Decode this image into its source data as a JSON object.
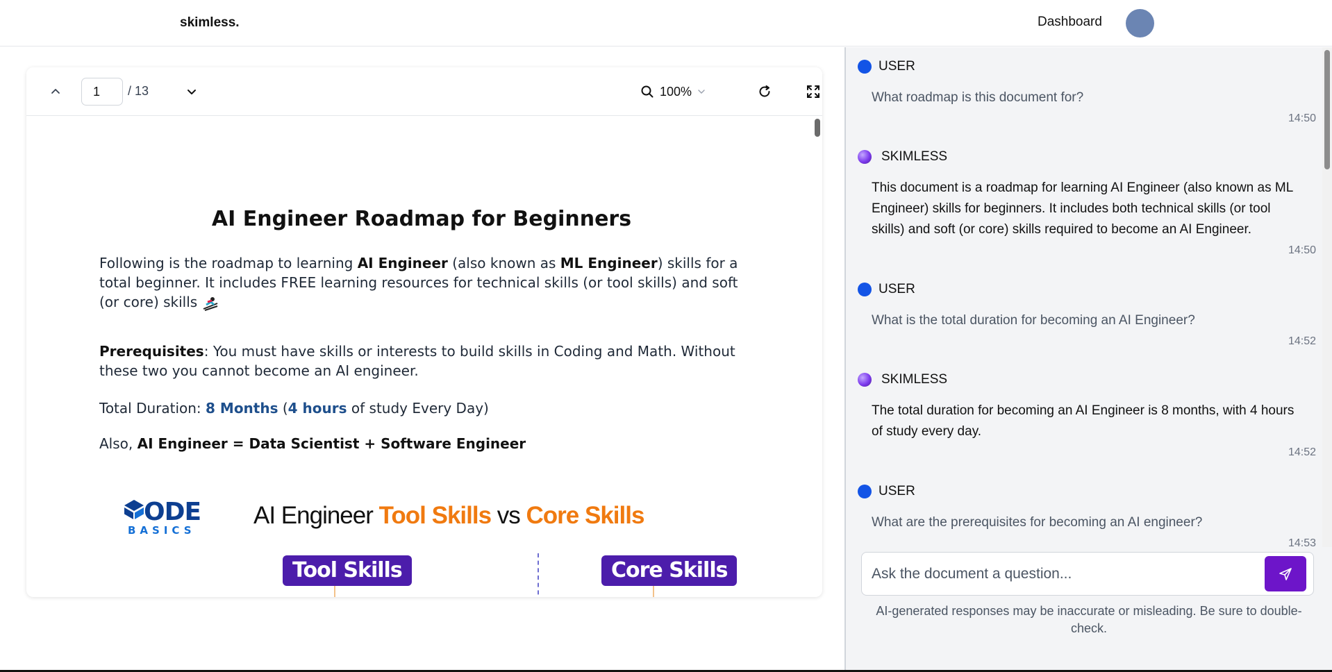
{
  "header": {
    "logo": "skimless.",
    "nav_dashboard": "Dashboard"
  },
  "viewer": {
    "page_current": "1",
    "page_total": "/ 13",
    "zoom": "100%"
  },
  "document": {
    "title": "AI Engineer Roadmap for Beginners",
    "p1": {
      "a": "Following is the roadmap to learning ",
      "b": "AI Engineer",
      "c": " (also known as ",
      "d": "ML Engineer",
      "e": ") skills for a total beginner. It includes FREE learning resources for technical skills (or tool skills) and soft (or core) skills"
    },
    "p2": {
      "a": "Prerequisites",
      "b": ": You must have skills or interests to build skills in Coding and Math. Without these two you cannot become an AI engineer."
    },
    "p3": {
      "a": "Total Duration: ",
      "b": "8 Months",
      "c": " (",
      "d": "4 hours",
      "e": " of study Every Day)"
    },
    "p4": {
      "a": "Also, ",
      "b": "AI Engineer = Data Scientist + Software Engineer"
    },
    "infographic": {
      "logo_main": "ODE",
      "logo_sub": "BASICS",
      "title_a": "AI Engineer ",
      "title_b": "Tool Skills",
      "title_c": " vs ",
      "title_d": "Core Skills",
      "pill_tool": "Tool Skills",
      "pill_core": "Core Skills"
    }
  },
  "chat": {
    "messages": [
      {
        "role": "USER",
        "text": "What roadmap is this document for?",
        "time": "14:50"
      },
      {
        "role": "SKIMLESS",
        "text": "This document is a roadmap for learning AI Engineer (also known as ML Engineer) skills for beginners. It includes both technical skills (or tool skills) and soft (or core) skills required to become an AI Engineer.",
        "time": "14:50"
      },
      {
        "role": "USER",
        "text": "What is the total duration for becoming an AI Engineer?",
        "time": "14:52"
      },
      {
        "role": "SKIMLESS",
        "text": "The total duration for becoming an AI Engineer is 8 months, with 4 hours of study every day.",
        "time": "14:52"
      },
      {
        "role": "USER",
        "text": "What are the prerequisites for becoming an AI engineer?",
        "time": "14:53"
      }
    ],
    "input_placeholder": "Ask the document a question...",
    "disclaimer": "AI-generated responses may be inaccurate or misleading. Be sure to double-check."
  },
  "colors": {
    "accent": "#6d15c9",
    "user_dot": "#1354e6",
    "doc_highlight": "#1e4f8c",
    "orange": "#f07a10",
    "pill": "#4c1dab"
  },
  "icons": [
    "chevron-up-icon",
    "chevron-down-icon",
    "search-icon",
    "refresh-icon",
    "fullscreen-icon",
    "send-icon"
  ]
}
